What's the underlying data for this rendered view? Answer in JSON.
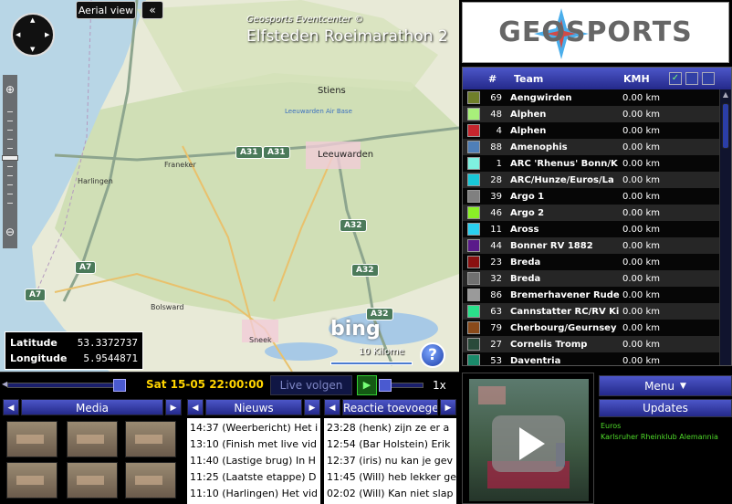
{
  "map": {
    "aerial_view_label": "Aerial view",
    "collapse_label": "«",
    "event_title": "Geosports Eventcenter ©",
    "event_subtitle": "Elfsteden Roeimarathon 2",
    "labels": {
      "stiens": "Stiens",
      "airbase": "Leeuwarden Air Base",
      "leeuwarden": "Leeuwarden",
      "franeker": "Franeker",
      "harlingen": "Harlingen",
      "bolsward": "Bolsward",
      "sneek": "Sneek"
    },
    "roads": [
      "A31",
      "A31",
      "A32",
      "A32",
      "A32",
      "A7",
      "A7"
    ],
    "coords": {
      "lat_label": "Latitude",
      "lat_value": "53.3372737",
      "lon_label": "Longitude",
      "lon_value": "5.9544871"
    },
    "provider": "bing",
    "scale": "10 Kilome",
    "help_label": "?"
  },
  "logo": {
    "text": "GEOSPORTS"
  },
  "team_table": {
    "headers": {
      "num": "#",
      "team": "Team",
      "kmh": "KMH"
    },
    "rows": [
      {
        "color": "#6f7f2a",
        "num": "69",
        "team": "Aengwirden",
        "kmh": "0.00 km"
      },
      {
        "color": "#a8f07a",
        "num": "48",
        "team": "Alphen",
        "kmh": "0.00 km"
      },
      {
        "color": "#c6262e",
        "num": "4",
        "team": "Alphen",
        "kmh": "0.00 km"
      },
      {
        "color": "#4f7fb8",
        "num": "88",
        "team": "Amenophis",
        "kmh": "0.00 km"
      },
      {
        "color": "#7ff0e0",
        "num": "1",
        "team": "ARC 'Rhenus' Bonn/K",
        "kmh": "0.00 km"
      },
      {
        "color": "#18c8d8",
        "num": "28",
        "team": "ARC/Hunze/Euros/La",
        "kmh": "0.00 km"
      },
      {
        "color": "#808080",
        "num": "39",
        "team": "Argo 1",
        "kmh": "0.00 km"
      },
      {
        "color": "#8af026",
        "num": "46",
        "team": "Argo 2",
        "kmh": "0.00 km"
      },
      {
        "color": "#2ad0f0",
        "num": "11",
        "team": "Aross",
        "kmh": "0.00 km"
      },
      {
        "color": "#5a1a8a",
        "num": "44",
        "team": "Bonner RV 1882",
        "kmh": "0.00 km"
      },
      {
        "color": "#8a1010",
        "num": "23",
        "team": "Breda",
        "kmh": "0.00 km"
      },
      {
        "color": "#707070",
        "num": "32",
        "team": "Breda",
        "kmh": "0.00 km"
      },
      {
        "color": "#9a9a9a",
        "num": "86",
        "team": "Bremerhavener Rude",
        "kmh": "0.00 km"
      },
      {
        "color": "#2ae08a",
        "num": "63",
        "team": "Cannstatter RC/RV Ki",
        "kmh": "0.00 km"
      },
      {
        "color": "#8a4a1a",
        "num": "79",
        "team": "Cherbourg/Geurnsey",
        "kmh": "0.00 km"
      },
      {
        "color": "#2a4a3a",
        "num": "27",
        "team": "Cornelis Tromp",
        "kmh": "0.00 km"
      },
      {
        "color": "#1a8a6a",
        "num": "53",
        "team": "Daventria",
        "kmh": "0.00 km"
      }
    ]
  },
  "timeline": {
    "datetime": "Sat 15-05 22:00:00",
    "live_label": "Live volgen",
    "speed": "1x"
  },
  "media": {
    "title": "Media"
  },
  "news": {
    "title": "Nieuws",
    "items": [
      "14:37 (Weerbericht) Het i",
      "13:10 (Finish met live vid",
      "11:40 (Lastige brug) In H",
      "11:25 (Laatste etappe) D",
      "11:10 (Harlingen) Het vid"
    ]
  },
  "reactions": {
    "title": "Reactie toevoegen",
    "items": [
      "23:28 (henk) zijn ze  er a",
      "12:54 (Bar Holstein) Erik",
      "12:37 (iris) nu kan je gev",
      "11:45 (Will) heb lekker ge",
      "02:02 (Will) Kan niet slap"
    ]
  },
  "menu": {
    "label": "Menu"
  },
  "updates": {
    "label": "Updates",
    "items": [
      "Euros",
      "Karlsruher Rheinklub Alemannia"
    ]
  }
}
